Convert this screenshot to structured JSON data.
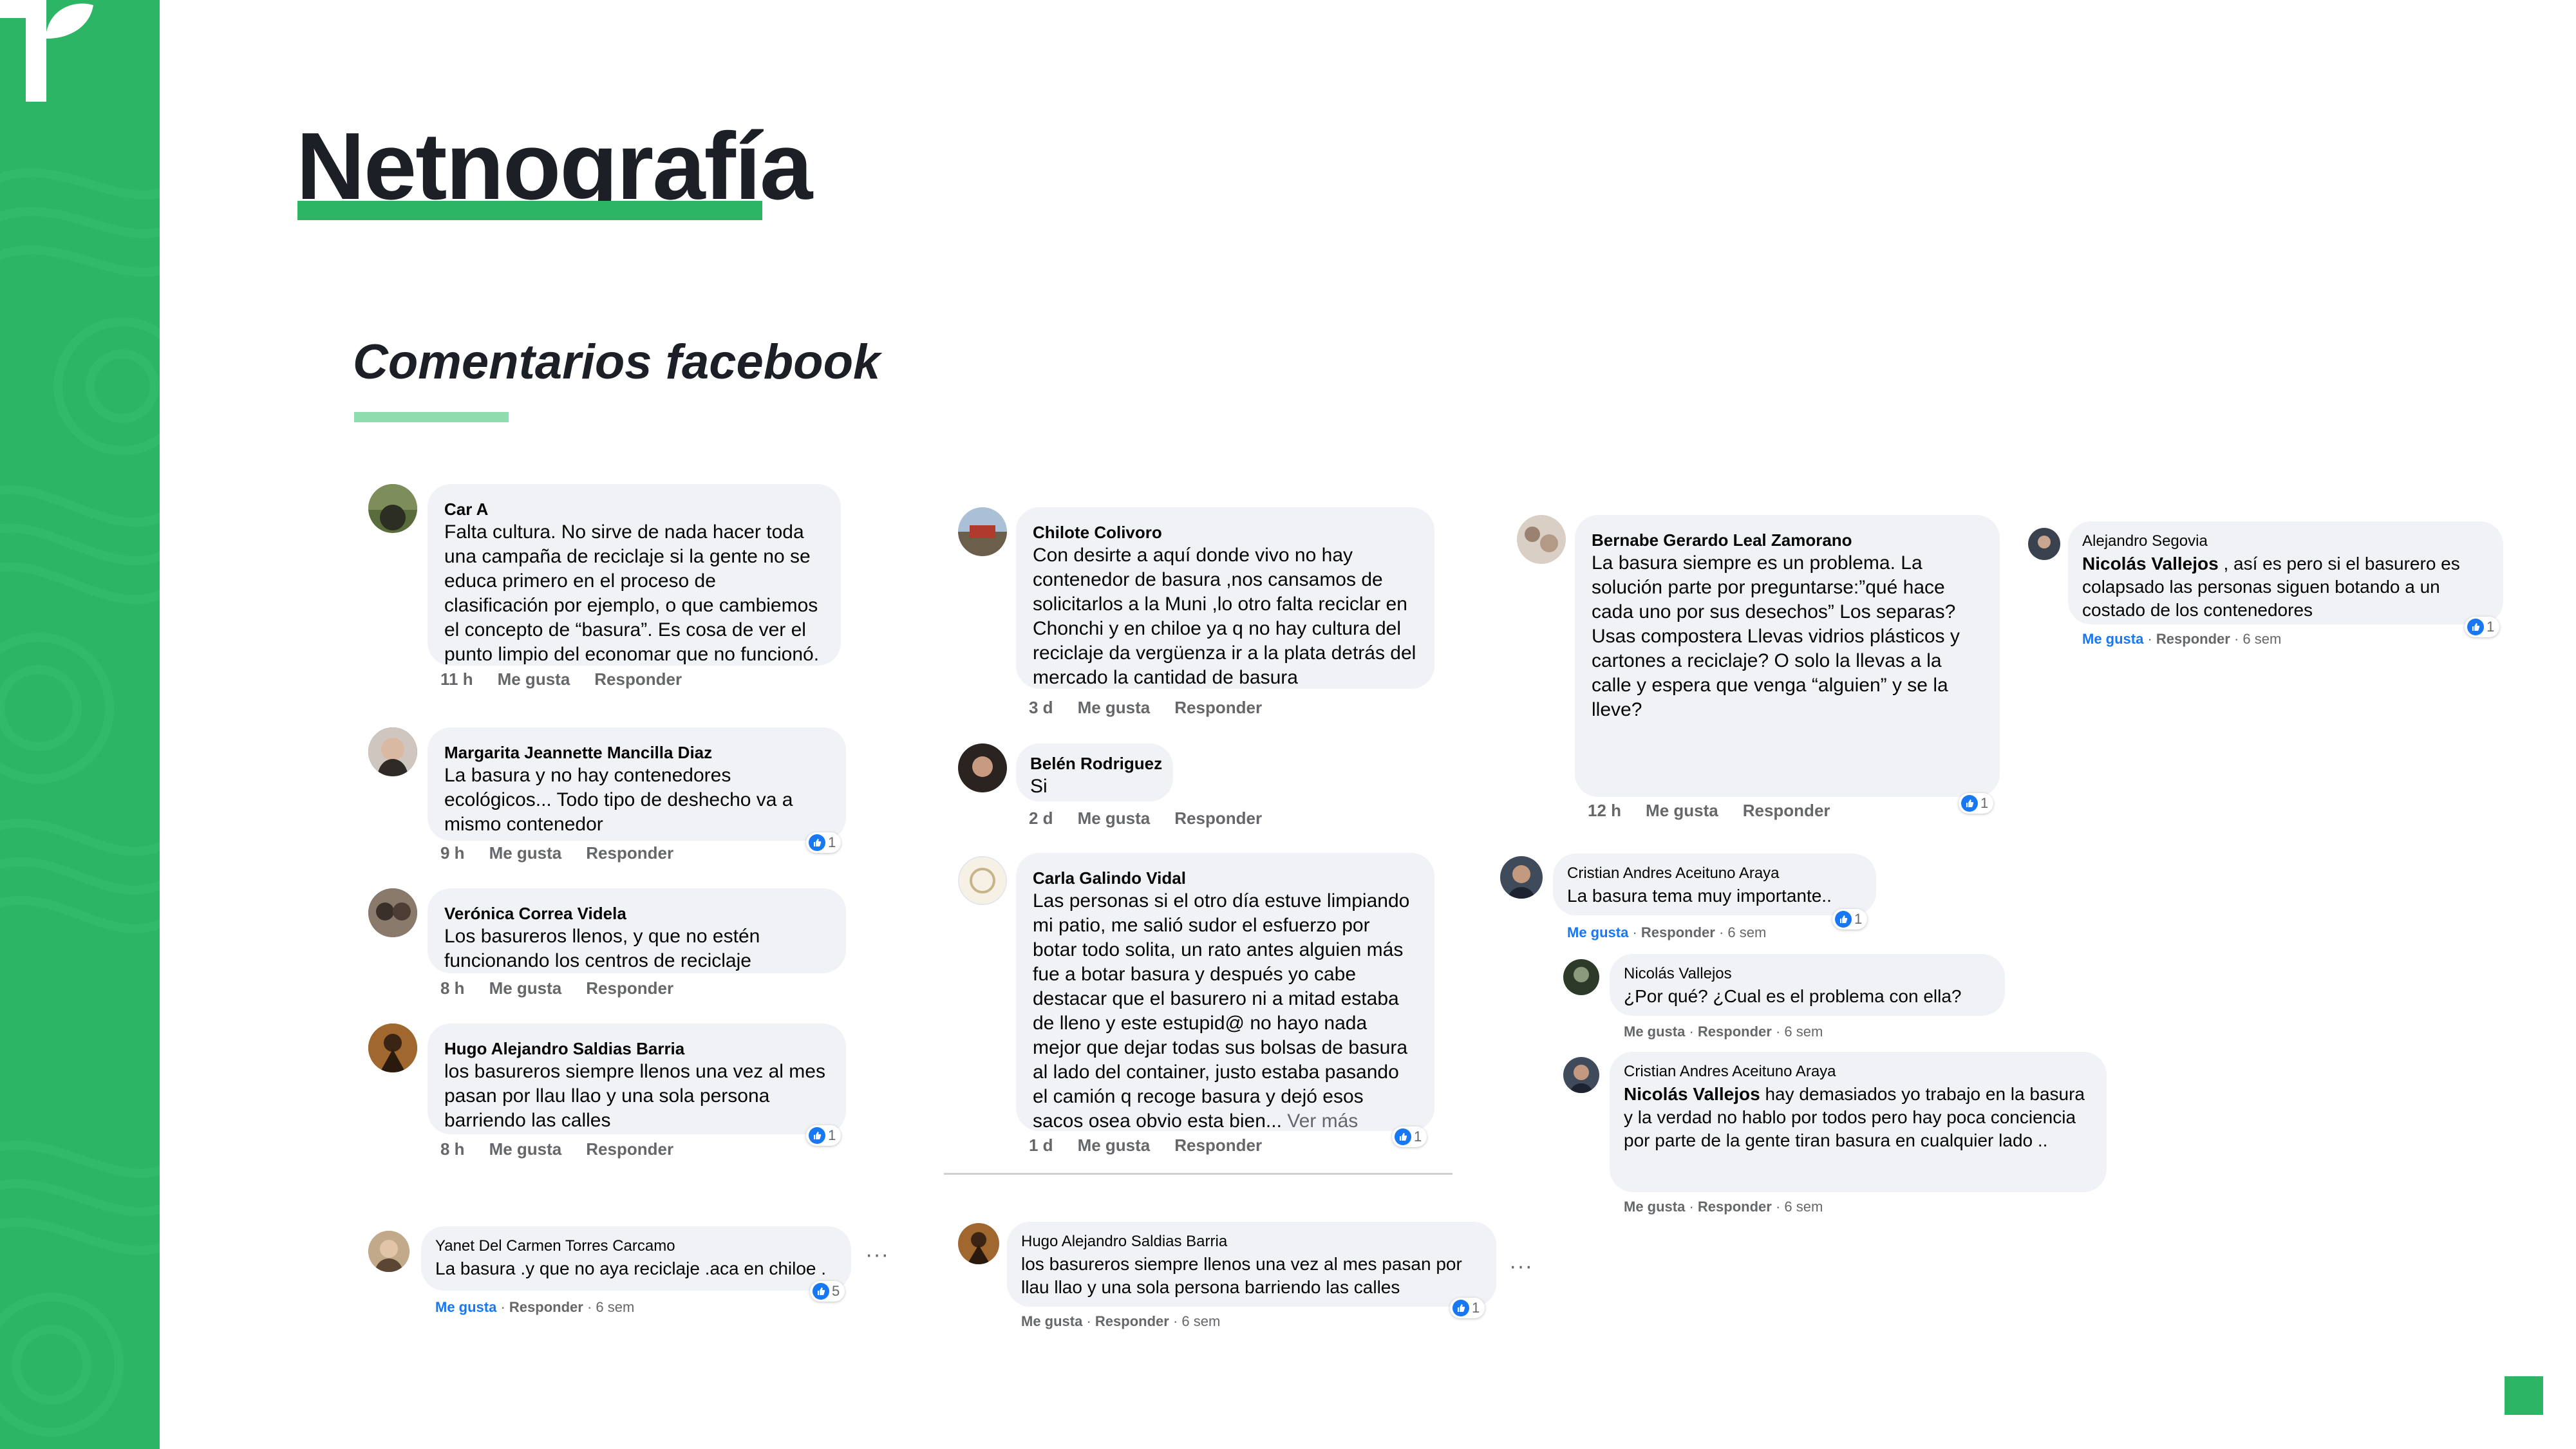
{
  "slide": {
    "title": "Netnografía",
    "subtitle": "Comentarios facebook",
    "colors": {
      "accent": "#2bb564",
      "accent_light": "#8fdcae",
      "bubble": "#f0f2f5",
      "link": "#1877f2"
    }
  },
  "col1": [
    {
      "author": "Car A",
      "text": "Falta cultura. No sirve de nada hacer toda una campaña de reciclaje si la gente no se educa primero en el proceso de clasificación por ejemplo, o que cambiemos el concepto de “basura”. Es cosa de ver el punto limpio del economar que no funcionó.",
      "time": "11 h",
      "like": "Me gusta",
      "reply": "Responder"
    },
    {
      "author": "Margarita Jeannette Mancilla Diaz",
      "text": "La basura y no hay contenedores ecológicos... Todo tipo de deshecho va a mismo contenedor",
      "time": "9 h",
      "like": "Me gusta",
      "reply": "Responder",
      "reactions": "1"
    },
    {
      "author": "Verónica Correa Videla",
      "text": "Los basureros llenos, y que no estén funcionando los centros de reciclaje",
      "time": "8 h",
      "like": "Me gusta",
      "reply": "Responder"
    },
    {
      "author": "Hugo Alejandro Saldias Barria",
      "text": "los basureros siempre llenos una vez al mes pasan por llau llao y una sola persona barriendo las calles",
      "time": "8 h",
      "like": "Me gusta",
      "reply": "Responder",
      "reactions": "1"
    },
    {
      "author": "Yanet Del Carmen Torres Carcamo",
      "text": "La basura .y que no aya reciclaje .aca en chiloe .",
      "like": "Me gusta",
      "reply": "Responder",
      "time": "6 sem",
      "reactions": "5"
    }
  ],
  "col2": [
    {
      "author": "Chilote Colivoro",
      "text": "Con desirte a aquí donde vivo no hay contenedor de basura ,nos cansamos de solicitarlos a la Muni ,lo otro falta reciclar en Chonchi y en chiloe ya q no hay cultura del reciclaje da vergüenza ir a la plata detrás del mercado la cantidad de basura",
      "time": "3 d",
      "like": "Me gusta",
      "reply": "Responder"
    },
    {
      "author": "Belén Rodriguez",
      "text": "Si",
      "time": "2 d",
      "like": "Me gusta",
      "reply": "Responder"
    },
    {
      "author": "Carla Galindo Vidal",
      "text": "Las personas si el otro día estuve limpiando mi patio, me salió sudor el esfuerzo por botar todo solita, un rato antes alguien más fue a botar basura y después yo cabe destacar que el basurero ni a mitad estaba de lleno y este estupid@ no hayo nada mejor que dejar todas sus bolsas de basura al lado del container, justo estaba pasando el camión q recoge basura y dejó esos sacos osea obvio esta bien...",
      "see_more": "Ver más",
      "time": "1 d",
      "like": "Me gusta",
      "reply": "Responder",
      "reactions": "1"
    },
    {
      "author": "Hugo Alejandro Saldias Barria",
      "text": "los basureros siempre llenos una vez al mes pasan por llau llao y una sola persona barriendo las calles",
      "like": "Me gusta",
      "reply": "Responder",
      "time": "6 sem",
      "reactions": "1"
    }
  ],
  "col3": [
    {
      "author": "Bernabe Gerardo Leal Zamorano",
      "text": "La basura siempre es un problema. La solución parte por preguntarse:”qué hace cada uno por sus desechos” Los separas? Usas compostera Llevas vidrios plásticos y cartones a reciclaje? O solo la llevas a la calle y espera que venga “alguien” y se la lleve?",
      "time": "12 h",
      "like": "Me gusta",
      "reply": "Responder",
      "reactions": "1"
    },
    {
      "author": "Cristian Andres Aceituno Araya",
      "text": "La basura tema muy importante..",
      "like": "Me gusta",
      "reply": "Responder",
      "time": "6 sem",
      "reactions": "1"
    },
    {
      "author": "Nicolás Vallejos",
      "text": "¿Por qué? ¿Cual es el problema con ella?",
      "like": "Me gusta",
      "reply": "Responder",
      "time": "6 sem"
    },
    {
      "author": "Cristian Andres Aceituno Araya",
      "mention": "Nicolás Vallejos",
      "text": " hay demasiados yo trabajo en la basura y la verdad no hablo por todos pero hay poca conciencia por parte de la gente tiran basura en cualquier lado ..",
      "like": "Me gusta",
      "reply": "Responder",
      "time": "6 sem"
    }
  ],
  "col4": [
    {
      "author": "Alejandro Segovia",
      "mention": "Nicolás Vallejos",
      "text": " , así es pero si el basurero es colapsado las personas siguen botando a un costado de los contenedores",
      "like": "Me gusta",
      "reply": "Responder",
      "time": "6 sem",
      "reactions": "1"
    }
  ],
  "dots": "···",
  "icons": [
    "logo-mark",
    "like-icon",
    "more-options-icon",
    "avatar"
  ]
}
